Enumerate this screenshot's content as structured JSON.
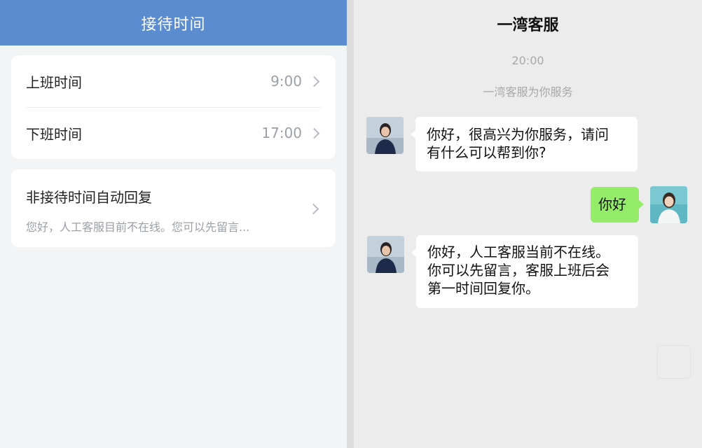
{
  "left_panel": {
    "header_title": "接待时间",
    "hours": {
      "start_label": "上班时间",
      "start_value": "9:00",
      "end_label": "下班时间",
      "end_value": "17:00"
    },
    "auto_reply": {
      "title": "非接待时间自动回复",
      "preview": "您好，人工客服目前不在线。您可以先留言..."
    }
  },
  "chat": {
    "title": "一湾客服",
    "time": "20:00",
    "notice": "一湾客服为你服务",
    "messages": [
      {
        "side": "left",
        "lines": [
          "你好，很高兴为你服务，请问",
          "有什么可以帮到你?"
        ]
      },
      {
        "side": "right",
        "lines": [
          "你好"
        ]
      },
      {
        "side": "left",
        "lines": [
          "你好，人工客服当前不在线。",
          "你可以先留言，客服上班后会",
          "第一时间回复你。"
        ]
      }
    ]
  },
  "colors": {
    "header_blue": "#5b8ccf",
    "self_bubble_green": "#95ec69"
  },
  "icons": {
    "row_arrow": "chevron-right-icon",
    "agent_avatar": "agent-avatar",
    "user_avatar": "user-avatar"
  }
}
